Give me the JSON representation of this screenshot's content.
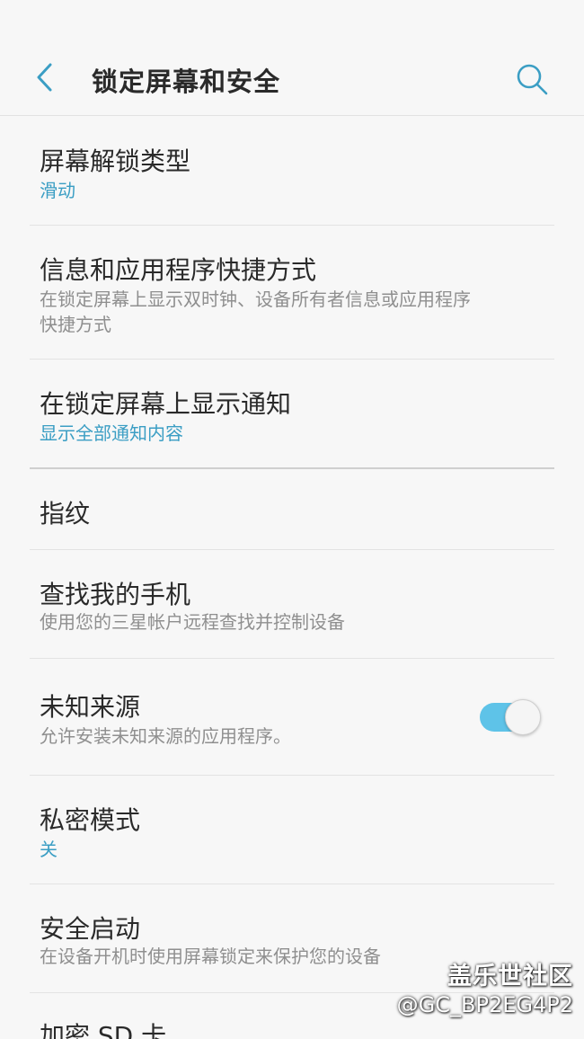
{
  "header": {
    "title": "锁定屏幕和安全",
    "back_icon": "chevron-left-icon",
    "search_icon": "search-icon"
  },
  "colors": {
    "accent": "#3b9ec4",
    "toggle_on": "#5ec3e8",
    "background": "#f7f7f7"
  },
  "items": [
    {
      "label": "屏幕解锁类型",
      "sub": "滑动"
    },
    {
      "label": "信息和应用程序快捷方式",
      "sub_line1": "在锁定屏幕上显示双时钟、设备所有者信息或应用程序",
      "sub_line2": "快捷方式"
    },
    {
      "label": "在锁定屏幕上显示通知",
      "sub": "显示全部通知内容"
    },
    {
      "label": "指纹"
    },
    {
      "label": "查找我的手机",
      "sub": "使用您的三星帐户远程查找并控制设备"
    },
    {
      "label": "未知来源",
      "sub": "允许安装未知来源的应用程序。",
      "toggle_on": true
    },
    {
      "label": "私密模式",
      "sub": "关"
    },
    {
      "label": "安全启动",
      "sub": "在设备开机时使用屏幕锁定来保护您的设备"
    },
    {
      "label": "加密 SD 卡"
    }
  ],
  "watermark": {
    "site": "盖乐世社区",
    "user": "@GC_BP2EG4P2"
  }
}
